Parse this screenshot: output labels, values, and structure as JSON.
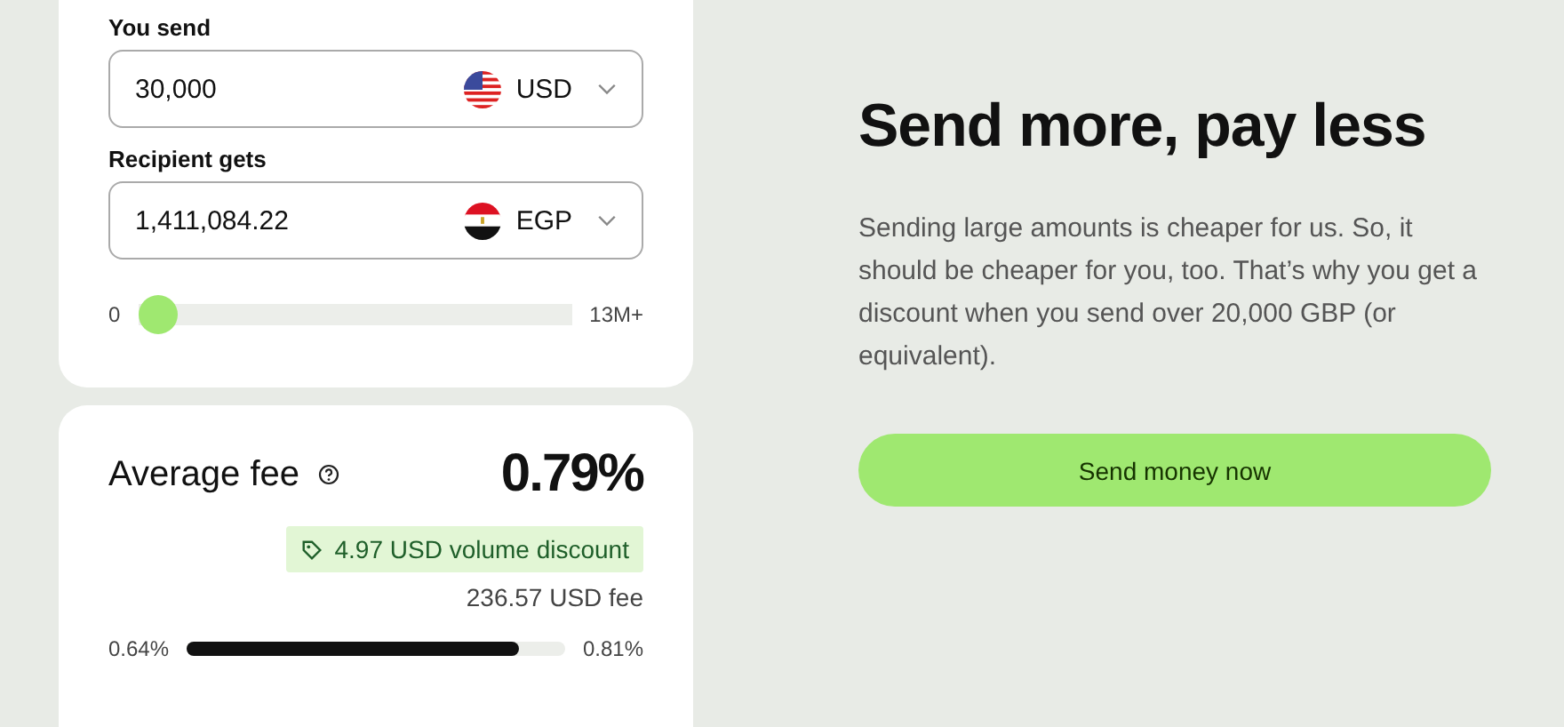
{
  "converter": {
    "send": {
      "label": "You send",
      "value": "30,000",
      "currency": "USD"
    },
    "receive": {
      "label": "Recipient gets",
      "value": "1,411,084.22",
      "currency": "EGP"
    },
    "slider": {
      "min": "0",
      "max": "13M+",
      "level": 0.0
    }
  },
  "fee": {
    "title": "Average fee",
    "rate": "0.79%",
    "discount": "4.97 USD volume discount",
    "amount": "236.57 USD fee",
    "range": {
      "min": "0.64%",
      "max": "0.81%",
      "level": 0.88
    }
  },
  "promo": {
    "heading": "Send more, pay less",
    "body": "Sending large amounts is cheaper for us. So, it should be cheaper for you, too. That’s why you get a discount when you send over 20,000 GBP (or equivalent).",
    "button": "Send money now"
  }
}
